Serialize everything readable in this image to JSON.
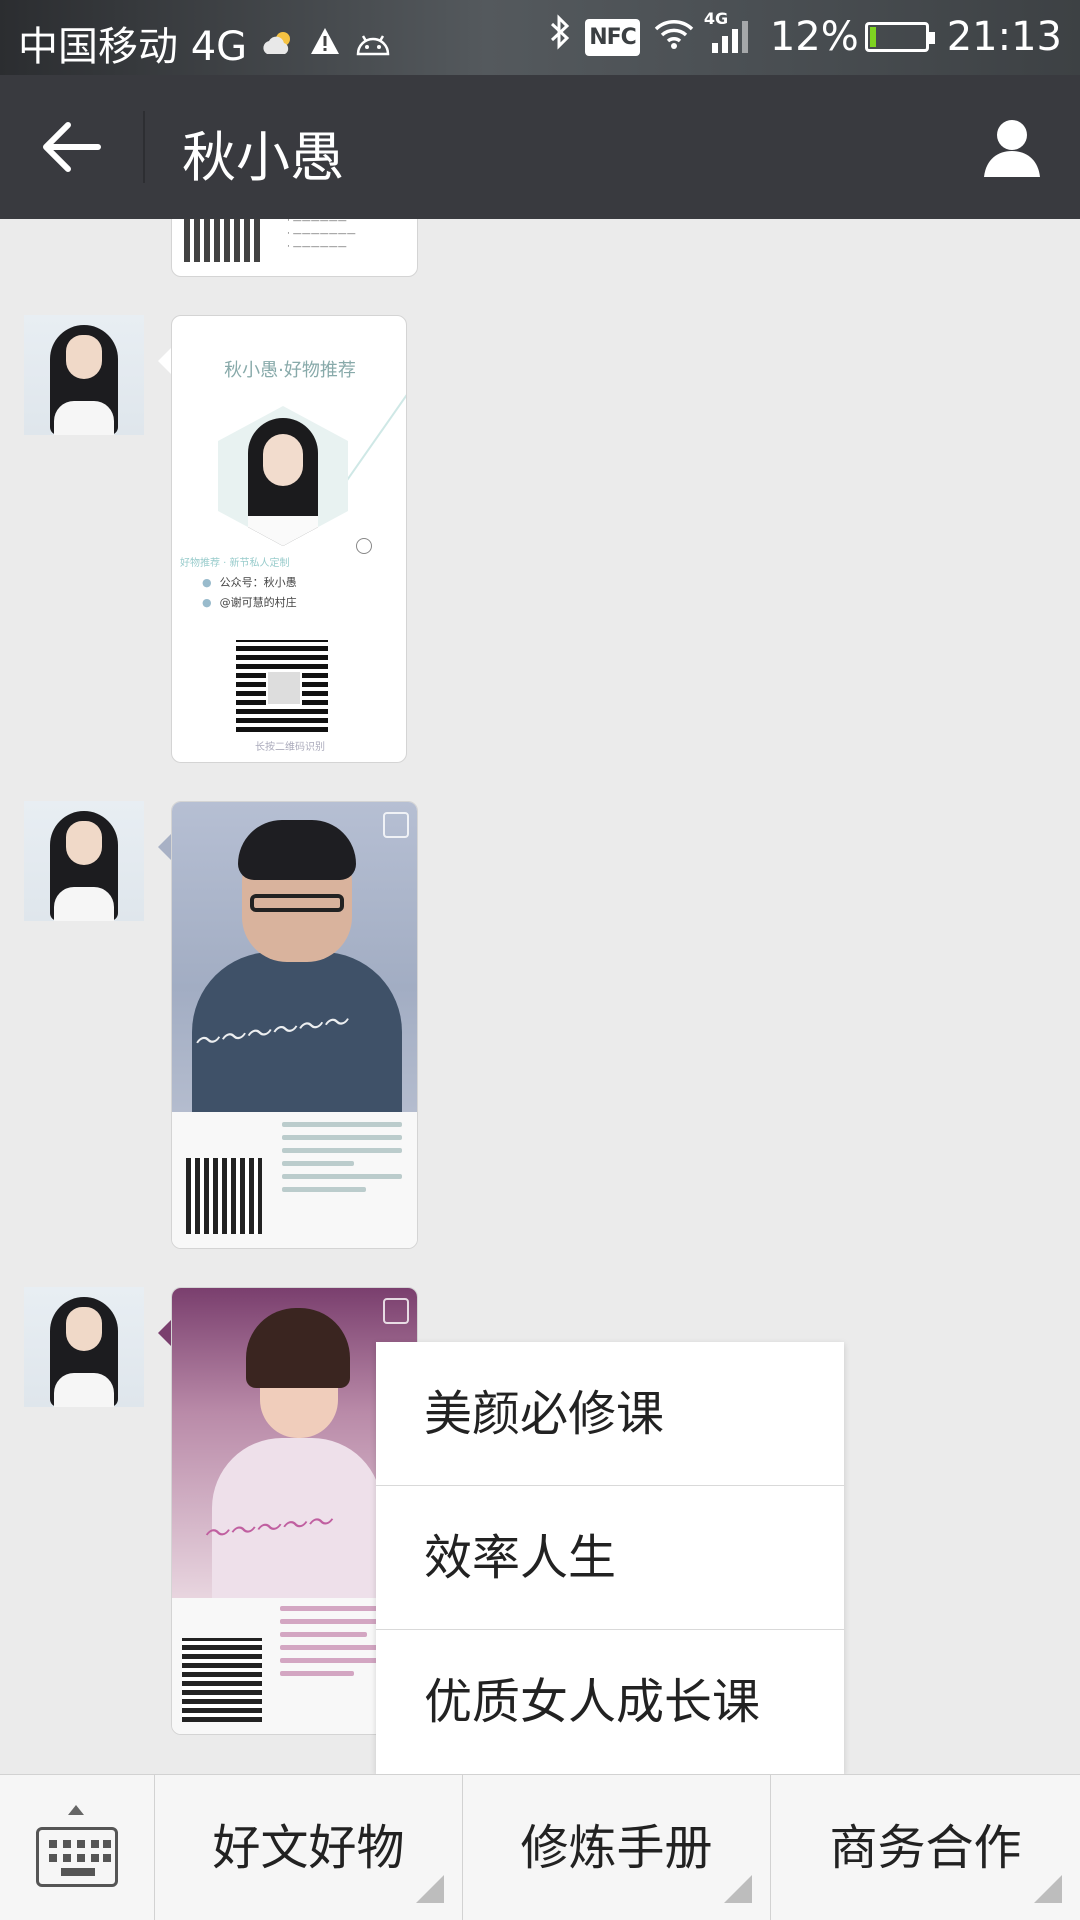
{
  "status_bar": {
    "carrier": "中国移动 4G",
    "network_badge": "4G",
    "nfc_label": "NFC",
    "battery": "12%",
    "battery_level": 0.12,
    "time": "21:13",
    "icons": [
      "cloud-sun-icon",
      "warning-icon",
      "android-icon",
      "bluetooth-icon",
      "nfc-icon",
      "wifi-icon",
      "signal-icon",
      "battery-icon"
    ]
  },
  "title_bar": {
    "title": "秋小愚",
    "back_icon": "back-arrow-icon",
    "profile_icon": "person-icon"
  },
  "messages": [
    {
      "type": "image",
      "name": "card-top"
    },
    {
      "type": "image",
      "name": "card-recommend",
      "card_title": "秋小愚·好物推荐",
      "tag": "好物推荐 · 新节私人定制",
      "rows": [
        "公众号：秋小愚",
        "@谢可慧的村庄"
      ],
      "footer": "长按二维码识别"
    },
    {
      "type": "image",
      "name": "card-efficiency"
    },
    {
      "type": "image",
      "name": "card-women"
    }
  ],
  "popup_menu": {
    "items": [
      "美颜必修课",
      "效率人生",
      "优质女人成长课"
    ]
  },
  "bottom_menu": {
    "keyboard_icon": "keyboard-icon",
    "buttons": [
      "好文好物",
      "修炼手册",
      "商务合作"
    ]
  },
  "colors": {
    "title_bar_bg": "#393a3f",
    "chat_bg": "#ebebeb",
    "battery_fill": "#7ed321"
  }
}
